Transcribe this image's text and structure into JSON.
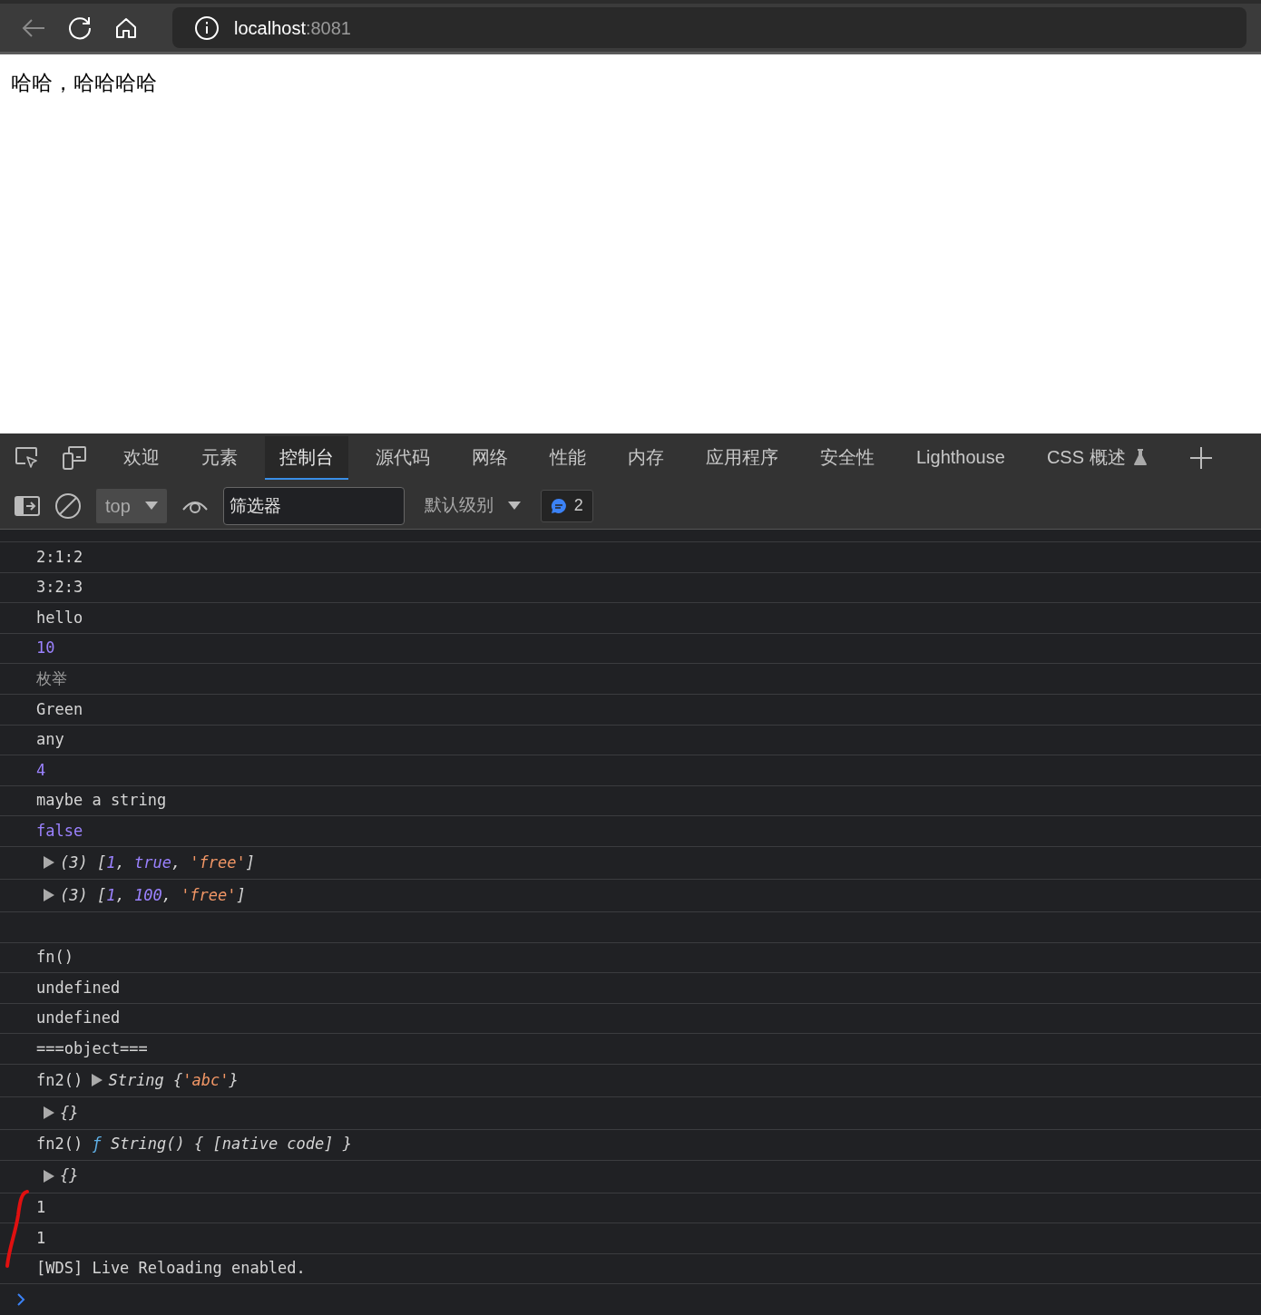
{
  "browser": {
    "back_disabled": true,
    "address": {
      "host": "localhost",
      "port": ":8081"
    }
  },
  "page": {
    "text": "哈哈，哈哈哈哈"
  },
  "devtools": {
    "tabs": [
      {
        "label": "欢迎",
        "selected": false
      },
      {
        "label": "元素",
        "selected": false
      },
      {
        "label": "控制台",
        "selected": true
      },
      {
        "label": "源代码",
        "selected": false
      },
      {
        "label": "网络",
        "selected": false
      },
      {
        "label": "性能",
        "selected": false
      },
      {
        "label": "内存",
        "selected": false
      },
      {
        "label": "应用程序",
        "selected": false
      },
      {
        "label": "安全性",
        "selected": false
      },
      {
        "label": "Lighthouse",
        "selected": false
      },
      {
        "label": "CSS 概述",
        "selected": false,
        "experimental": true
      }
    ],
    "toolbar": {
      "context": "top",
      "filter": {
        "placeholder": "筛选器"
      },
      "levels": "默认级别",
      "messages": "2"
    },
    "console": [
      {
        "kind": "log",
        "tokens": [
          {
            "kind": "text",
            "text": "2:1:2"
          }
        ]
      },
      {
        "kind": "log",
        "tokens": [
          {
            "kind": "text",
            "text": "3:2:3"
          }
        ]
      },
      {
        "kind": "log",
        "tokens": [
          {
            "kind": "text",
            "text": "hello"
          }
        ]
      },
      {
        "kind": "log",
        "tokens": [
          {
            "kind": "number",
            "text": "10"
          }
        ]
      },
      {
        "kind": "log",
        "tokens": [
          {
            "kind": "muted",
            "text": "枚举"
          }
        ]
      },
      {
        "kind": "log",
        "tokens": [
          {
            "kind": "text",
            "text": "Green"
          }
        ]
      },
      {
        "kind": "log",
        "tokens": [
          {
            "kind": "text",
            "text": "any"
          }
        ]
      },
      {
        "kind": "log",
        "tokens": [
          {
            "kind": "number",
            "text": "4"
          }
        ]
      },
      {
        "kind": "log",
        "tokens": [
          {
            "kind": "text",
            "text": "maybe a string"
          }
        ]
      },
      {
        "kind": "log",
        "tokens": [
          {
            "kind": "number",
            "text": "false"
          }
        ]
      },
      {
        "kind": "log",
        "tokens": [
          {
            "kind": "toggle"
          },
          {
            "kind": "text",
            "italic": true,
            "text": "(3) ["
          },
          {
            "kind": "number",
            "italic": true,
            "text": "1"
          },
          {
            "kind": "text",
            "italic": true,
            "text": ", "
          },
          {
            "kind": "number",
            "italic": true,
            "text": "true"
          },
          {
            "kind": "text",
            "italic": true,
            "text": ", "
          },
          {
            "kind": "string",
            "italic": true,
            "text": "'free'"
          },
          {
            "kind": "text",
            "italic": true,
            "text": "]"
          }
        ]
      },
      {
        "kind": "log",
        "tokens": [
          {
            "kind": "toggle"
          },
          {
            "kind": "text",
            "italic": true,
            "text": "(3) ["
          },
          {
            "kind": "number",
            "italic": true,
            "text": "1"
          },
          {
            "kind": "text",
            "italic": true,
            "text": ", "
          },
          {
            "kind": "number",
            "italic": true,
            "text": "100"
          },
          {
            "kind": "text",
            "italic": true,
            "text": ", "
          },
          {
            "kind": "string",
            "italic": true,
            "text": "'free'"
          },
          {
            "kind": "text",
            "italic": true,
            "text": "]"
          }
        ]
      },
      {
        "kind": "blank"
      },
      {
        "kind": "log",
        "tokens": [
          {
            "kind": "text",
            "text": "fn()"
          }
        ]
      },
      {
        "kind": "log",
        "tokens": [
          {
            "kind": "text",
            "text": "undefined"
          }
        ]
      },
      {
        "kind": "log",
        "tokens": [
          {
            "kind": "text",
            "text": "undefined"
          }
        ]
      },
      {
        "kind": "log",
        "tokens": [
          {
            "kind": "text",
            "text": "===object==="
          }
        ]
      },
      {
        "kind": "log",
        "tokens": [
          {
            "kind": "text",
            "text": "fn2() "
          },
          {
            "kind": "toggle"
          },
          {
            "kind": "text",
            "italic": true,
            "text": "String {"
          },
          {
            "kind": "string",
            "italic": true,
            "text": "'abc'"
          },
          {
            "kind": "text",
            "italic": true,
            "text": "}"
          }
        ]
      },
      {
        "kind": "log",
        "tokens": [
          {
            "kind": "toggle"
          },
          {
            "kind": "text",
            "italic": true,
            "text": "{}"
          }
        ]
      },
      {
        "kind": "log",
        "tokens": [
          {
            "kind": "text",
            "text": "fn2() "
          },
          {
            "kind": "function",
            "italic": true,
            "text": "ƒ"
          },
          {
            "kind": "text",
            "italic": true,
            "text": " String() { [native code] }"
          }
        ]
      },
      {
        "kind": "log",
        "tokens": [
          {
            "kind": "toggle"
          },
          {
            "kind": "text",
            "italic": true,
            "text": "{}"
          }
        ]
      },
      {
        "kind": "log",
        "tokens": [
          {
            "kind": "text",
            "text": "1"
          }
        ]
      },
      {
        "kind": "log",
        "tokens": [
          {
            "kind": "text",
            "text": "1"
          }
        ]
      },
      {
        "kind": "log",
        "tokens": [
          {
            "kind": "text",
            "text": "[WDS] Live Reloading enabled."
          }
        ]
      }
    ]
  }
}
